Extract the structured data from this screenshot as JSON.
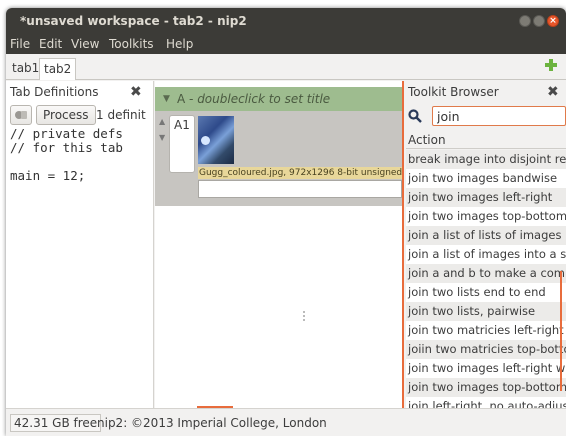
{
  "window": {
    "title": "*unsaved workspace - tab2 - nip2"
  },
  "menubar": {
    "items": [
      "File",
      "Edit",
      "View",
      "Toolkits",
      "Help"
    ]
  },
  "tabs": [
    {
      "label": "tab1",
      "active": false
    },
    {
      "label": "tab2",
      "active": true
    }
  ],
  "tab_definitions": {
    "title": "Tab Definitions",
    "process_label": "Process",
    "info": "1 definit",
    "code": "// private defs\n// for this tab\n\nmain = 12;"
  },
  "column": {
    "name": "A",
    "title_hint": "doubleclick to set title",
    "row_label": "A1",
    "caption": "Gugg_coloured.jpg, 972x1296 8-bit unsigned",
    "header_color": "#9ebc8f"
  },
  "toolkit_browser": {
    "title": "Toolkit Browser",
    "search_value": "join",
    "column_header": "Action",
    "items": [
      "break image into disjoint reg",
      "join two images bandwise",
      "join two images left-right",
      "join two images top-bottom",
      "join a list of lists of images in",
      "join a list of images into a sin",
      "join a and b to make a comple",
      "join two lists end to end",
      "join two lists, pairwise",
      "join two matricies left-right",
      "joiin two matricies top-botto",
      "join two images left-right wit",
      "join two images top-bottom v",
      "join left-right, no auto-adjust"
    ]
  },
  "status": {
    "free": "42.31 GB free",
    "text": "nip2: ©2013 Imperial College, London"
  },
  "colors": {
    "accent": "#e86c3c",
    "titlebar": "#3c3b37"
  }
}
